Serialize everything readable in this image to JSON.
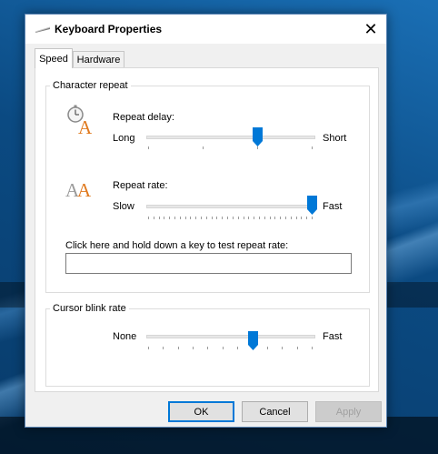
{
  "window": {
    "title": "Keyboard Properties",
    "close_glyph": "✕"
  },
  "tabs": [
    {
      "label": "Speed",
      "selected": true
    },
    {
      "label": "Hardware",
      "selected": false
    }
  ],
  "character_repeat": {
    "group_label": "Character repeat",
    "repeat_delay": {
      "label": "Repeat delay:",
      "min_label": "Long",
      "max_label": "Short",
      "value": 2,
      "max": 3,
      "icon": "stopwatch-letter-a-icon"
    },
    "repeat_rate": {
      "label": "Repeat rate:",
      "min_label": "Slow",
      "max_label": "Fast",
      "value": 31,
      "max": 31,
      "icon": "double-letter-a-icon"
    },
    "test_label": "Click here and hold down a key to test repeat rate:",
    "test_value": ""
  },
  "cursor_blink": {
    "group_label": "Cursor blink rate",
    "min_label": "None",
    "max_label": "Fast",
    "value": 7,
    "max": 11
  },
  "buttons": {
    "ok": "OK",
    "cancel": "Cancel",
    "apply": "Apply",
    "apply_enabled": false
  },
  "colors": {
    "accent": "#0078d7",
    "icon_orange": "#e07a1f"
  }
}
